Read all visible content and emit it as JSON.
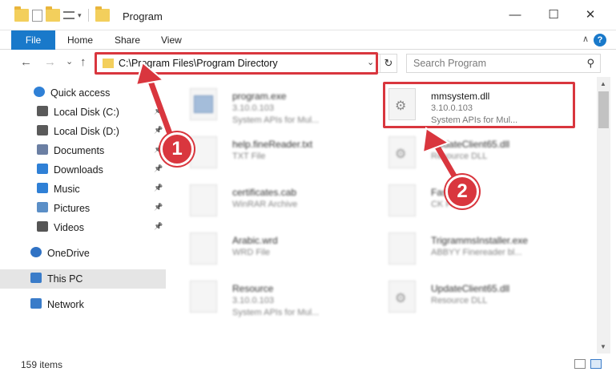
{
  "window": {
    "title": "Program",
    "minimize": "—",
    "maximize": "☐",
    "close": "✕"
  },
  "ribbon": {
    "tabs": [
      "File",
      "Home",
      "Share",
      "View"
    ],
    "help": "?",
    "collapse": "∧"
  },
  "nav": {
    "back": "←",
    "forward": "→",
    "recent": "⌄",
    "up": "↑",
    "address": "C:\\Program Files\\Program Directory",
    "refresh": "↻",
    "dropdown": "⌄",
    "search_placeholder": "Search Program",
    "search_icon": "⚲"
  },
  "sidebar": {
    "items": [
      {
        "label": "Quick access",
        "icon": "star-icon",
        "color": "#2f80d6",
        "pinned": false
      },
      {
        "label": "Local Disk (C:)",
        "icon": "drive-icon",
        "color": "#5a5a5a",
        "pinned": true
      },
      {
        "label": "Local Disk (D:)",
        "icon": "drive-icon",
        "color": "#5a5a5a",
        "pinned": true
      },
      {
        "label": "Documents",
        "icon": "documents-icon",
        "color": "#6b7fa3",
        "pinned": true
      },
      {
        "label": "Downloads",
        "icon": "downloads-icon",
        "color": "#2f80d6",
        "pinned": true
      },
      {
        "label": "Music",
        "icon": "music-icon",
        "color": "#2f80d6",
        "pinned": true
      },
      {
        "label": "Pictures",
        "icon": "pictures-icon",
        "color": "#5b8fc7",
        "pinned": true
      },
      {
        "label": "Videos",
        "icon": "videos-icon",
        "color": "#555555",
        "pinned": true
      },
      {
        "label": "OneDrive",
        "icon": "cloud-icon",
        "color": "#2f72c4",
        "pinned": false
      },
      {
        "label": "This PC",
        "icon": "computer-icon",
        "color": "#3a7cc9",
        "pinned": false
      },
      {
        "label": "Network",
        "icon": "network-icon",
        "color": "#3a7cc9",
        "pinned": false
      }
    ]
  },
  "files": [
    {
      "name": "program.exe",
      "line2": "3.10.0.103",
      "line3": "System APIs for Mul...",
      "icon": "exe-icon",
      "blurred": true
    },
    {
      "name": "mmsystem.dll",
      "line2": "3.10.0.103",
      "line3": "System APIs for Mul...",
      "icon": "dll-gear-icon",
      "blurred": false
    },
    {
      "name": "help.fineReader.txt",
      "line2": "TXT File",
      "line3": "",
      "icon": "txt-icon",
      "blurred": true
    },
    {
      "name": "UpdateClient65.dll",
      "line2": "Resource DLL",
      "line3": "",
      "icon": "dll-gear-icon",
      "blurred": true
    },
    {
      "name": "certificates.cab",
      "line2": "WinRAR Archive",
      "line3": "",
      "icon": "winrar-icon",
      "blurred": true
    },
    {
      "name": "FastBoot",
      "line2": "CK File",
      "line3": "",
      "icon": "file-icon",
      "blurred": true
    },
    {
      "name": "Arabic.wrd",
      "line2": "WRD File",
      "line3": "",
      "icon": "file-icon",
      "blurred": true
    },
    {
      "name": "TrigrammsInstaller.exe",
      "line2": "ABBYY Finereader bl...",
      "line3": "",
      "icon": "app-icon",
      "blurred": true
    },
    {
      "name": "Resource",
      "line2": "3.10.0.103",
      "line3": "System APIs for Mul...",
      "icon": "folder-doc-icon",
      "blurred": true
    },
    {
      "name": "UpdateClient65.dll",
      "line2": "Resource DLL",
      "line3": "",
      "icon": "dll-gear-icon",
      "blurred": true
    }
  ],
  "status": {
    "count": "159 items"
  },
  "annotations": {
    "step1": "1",
    "step2": "2",
    "color": "#d9363e"
  }
}
